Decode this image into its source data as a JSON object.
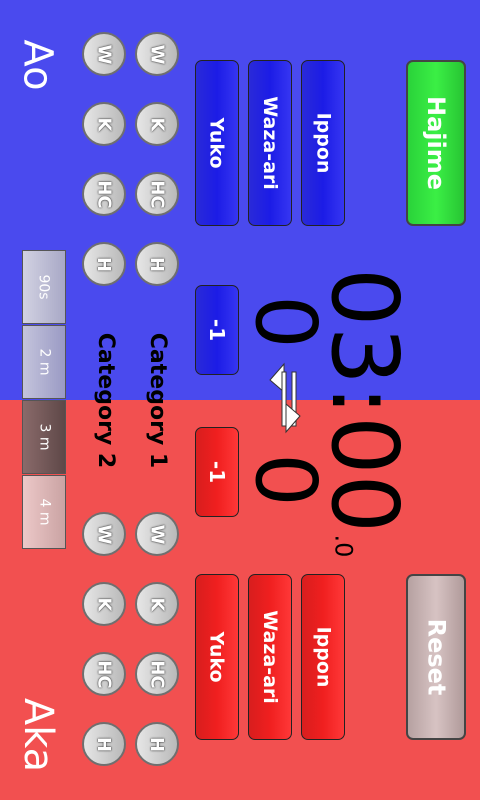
{
  "colors": {
    "blue": "#4a4aee",
    "red": "#f25050",
    "hajime": "#2fe03b",
    "reset": "#c9b0b0"
  },
  "blue_player": {
    "name": "Ao",
    "score": "0",
    "minus_label": "-1",
    "buttons": {
      "ippon": "Ippon",
      "wazaari": "Waza-ari",
      "yuko": "Yuko"
    },
    "penalties": {
      "w": "W",
      "k": "K",
      "hc": "HC",
      "h": "H"
    }
  },
  "red_player": {
    "name": "Aka",
    "score": "0",
    "minus_label": "-1",
    "buttons": {
      "ippon": "Ippon",
      "wazaari": "Waza-ari",
      "yuko": "Yuko"
    },
    "penalties": {
      "w": "W",
      "k": "K",
      "hc": "HC",
      "h": "H"
    }
  },
  "timer": {
    "main": "03:00",
    "fraction": ".0"
  },
  "controls": {
    "hajime": "Hajime",
    "reset": "Reset"
  },
  "categories": {
    "category1": "Category 1",
    "category2": "Category 2"
  },
  "durations": [
    {
      "label": "90s",
      "selected": false
    },
    {
      "label": "2 m",
      "selected": false
    },
    {
      "label": "3 m",
      "selected": true
    },
    {
      "label": "4 m",
      "selected": false
    }
  ],
  "swap_icon": "swap-arrows-icon"
}
